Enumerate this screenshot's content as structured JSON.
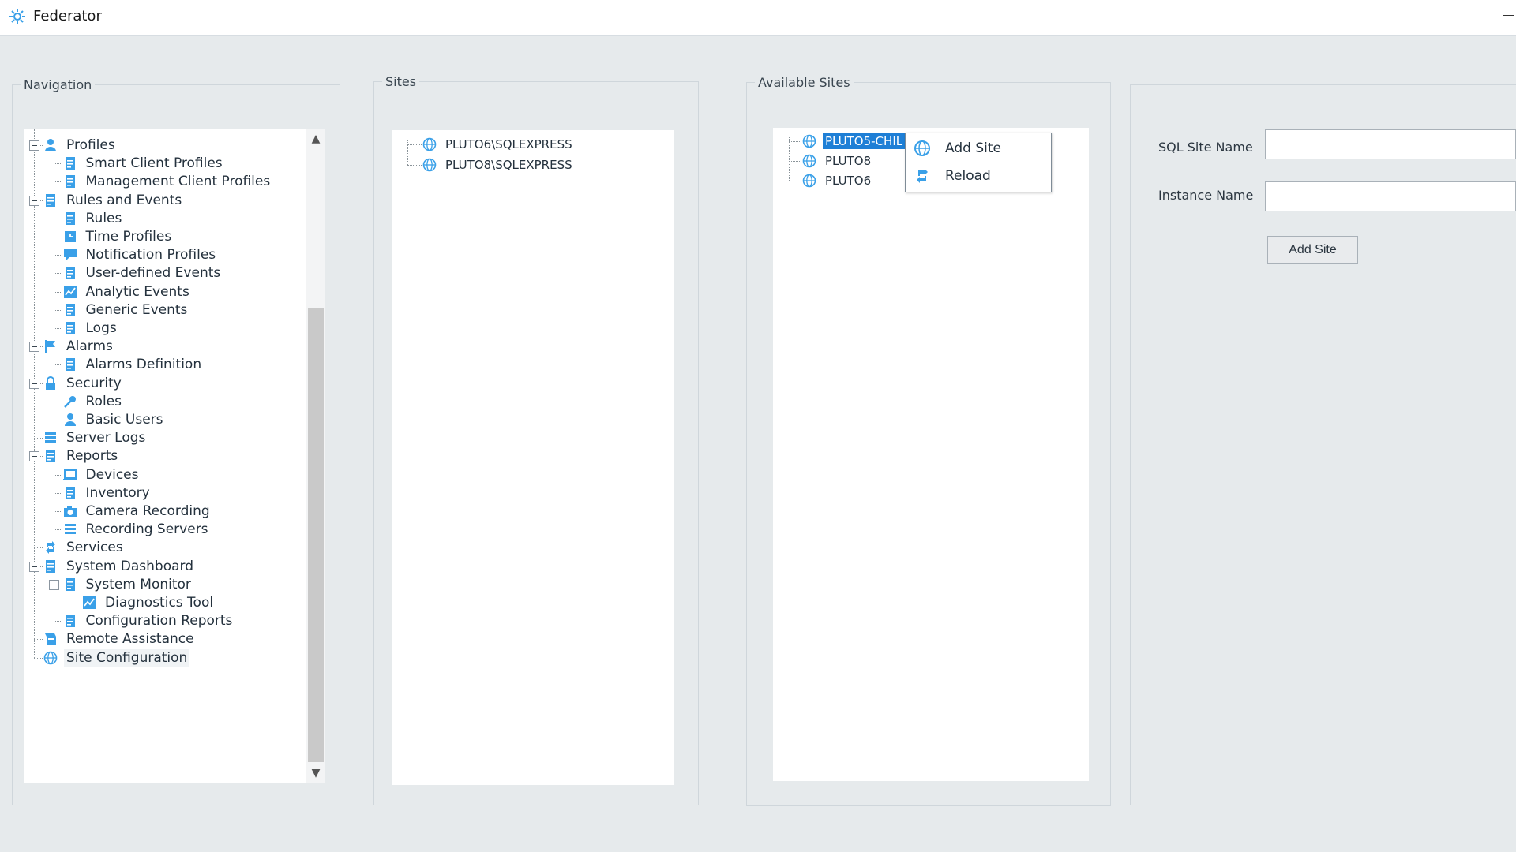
{
  "window": {
    "title": "Federator",
    "app_icon": "federator-gear-icon"
  },
  "colors": {
    "accent": "#1e7fd6",
    "icon_blue": "#3aa0e8",
    "background": "#e6eaec"
  },
  "navigation": {
    "label": "Navigation",
    "items": [
      {
        "label": "Profiles",
        "icon": "profiles-icon",
        "level": 0,
        "expanded": true
      },
      {
        "label": "Smart Client Profiles",
        "icon": "smart-client-profiles-icon",
        "level": 1
      },
      {
        "label": "Management Client Profiles",
        "icon": "management-client-profiles-icon",
        "level": 1
      },
      {
        "label": "Rules and Events",
        "icon": "rules-and-events-icon",
        "level": 0,
        "expanded": true
      },
      {
        "label": "Rules",
        "icon": "rules-icon",
        "level": 1
      },
      {
        "label": "Time Profiles",
        "icon": "time-profiles-icon",
        "level": 1
      },
      {
        "label": "Notification Profiles",
        "icon": "notification-profiles-icon",
        "level": 1
      },
      {
        "label": "User-defined Events",
        "icon": "user-defined-events-icon",
        "level": 1
      },
      {
        "label": "Analytic Events",
        "icon": "analytic-events-icon",
        "level": 1
      },
      {
        "label": "Generic Events",
        "icon": "generic-events-icon",
        "level": 1
      },
      {
        "label": "Logs",
        "icon": "logs-icon",
        "level": 1
      },
      {
        "label": "Alarms",
        "icon": "alarms-flag-icon",
        "level": 0,
        "expanded": true
      },
      {
        "label": "Alarms Definition",
        "icon": "alarms-definition-icon",
        "level": 1
      },
      {
        "label": "Security",
        "icon": "security-lock-icon",
        "level": 0,
        "expanded": true
      },
      {
        "label": "Roles",
        "icon": "roles-key-icon",
        "level": 1
      },
      {
        "label": "Basic Users",
        "icon": "basic-users-icon",
        "level": 1
      },
      {
        "label": "Server Logs",
        "icon": "server-logs-icon",
        "level": 0
      },
      {
        "label": "Reports",
        "icon": "reports-icon",
        "level": 0,
        "expanded": true
      },
      {
        "label": "Devices",
        "icon": "devices-icon",
        "level": 1
      },
      {
        "label": "Inventory",
        "icon": "inventory-icon",
        "level": 1
      },
      {
        "label": "Camera Recording",
        "icon": "camera-recording-icon",
        "level": 1
      },
      {
        "label": "Recording Servers",
        "icon": "recording-servers-icon",
        "level": 1
      },
      {
        "label": "Services",
        "icon": "services-icon",
        "level": 0
      },
      {
        "label": "System Dashboard",
        "icon": "system-dashboard-icon",
        "level": 0,
        "expanded": true
      },
      {
        "label": "System Monitor",
        "icon": "system-monitor-icon",
        "level": 1,
        "expanded": true
      },
      {
        "label": "Diagnostics Tool",
        "icon": "diagnostics-tool-icon",
        "level": 2
      },
      {
        "label": "Configuration Reports",
        "icon": "configuration-reports-icon",
        "level": 1
      },
      {
        "label": "Remote Assistance",
        "icon": "remote-assistance-icon",
        "level": 0
      },
      {
        "label": "Site Configuration",
        "icon": "site-configuration-globe-icon",
        "level": 0,
        "selected": true
      }
    ]
  },
  "sites": {
    "label": "Sites",
    "items": [
      {
        "label": "PLUTO6\\SQLEXPRESS",
        "icon": "globe-icon"
      },
      {
        "label": "PLUTO8\\SQLEXPRESS",
        "icon": "globe-icon"
      }
    ]
  },
  "available_sites": {
    "label": "Available Sites",
    "items": [
      {
        "label": "PLUTO5-CHIL",
        "icon": "globe-icon",
        "highlighted": true
      },
      {
        "label": "PLUTO8",
        "icon": "globe-icon"
      },
      {
        "label": "PLUTO6",
        "icon": "globe-icon"
      }
    ]
  },
  "context_menu": {
    "items": [
      {
        "label": "Add Site",
        "icon": "add-site-globe-icon"
      },
      {
        "label": "Reload",
        "icon": "reload-icon"
      }
    ]
  },
  "form": {
    "sql_site_name_label": "SQL Site Name",
    "sql_site_name_value": "",
    "instance_name_label": "Instance Name",
    "instance_name_value": "",
    "add_site_button": "Add Site"
  }
}
